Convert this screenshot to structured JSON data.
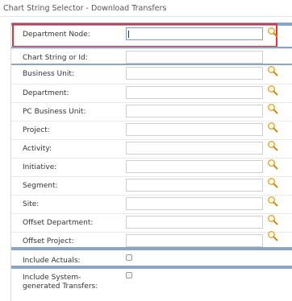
{
  "page": {
    "title": "Chart String Selector - Download Transfers"
  },
  "fields": [
    {
      "label": "Department Node:",
      "value": "",
      "lookup": true
    },
    {
      "label": "Chart String or Id:",
      "value": "",
      "lookup": false
    },
    {
      "label": "Business Unit:",
      "value": "",
      "lookup": true
    },
    {
      "label": "Department:",
      "value": "",
      "lookup": true
    },
    {
      "label": "PC Business Unit:",
      "value": "",
      "lookup": true
    },
    {
      "label": "Project:",
      "value": "",
      "lookup": true
    },
    {
      "label": "Activity:",
      "value": "",
      "lookup": true
    },
    {
      "label": "Initiative:",
      "value": "",
      "lookup": true
    },
    {
      "label": "Segment:",
      "value": "",
      "lookup": true
    },
    {
      "label": "Site:",
      "value": "",
      "lookup": true
    },
    {
      "label": "Offset Department:",
      "value": "",
      "lookup": true
    },
    {
      "label": "Offset Project:",
      "value": "",
      "lookup": true
    }
  ],
  "options": {
    "include_actuals": {
      "label": "Include Actuals:",
      "checked": false
    },
    "include_system_generated": {
      "label": "Include System-generated Transfers:",
      "checked": false
    }
  },
  "icons": {
    "lookup": "magnifier-icon"
  },
  "colors": {
    "section_band": "#8aa5c4",
    "focus_outline": "#e0353b",
    "lookup_lens": "#e3a72f"
  }
}
